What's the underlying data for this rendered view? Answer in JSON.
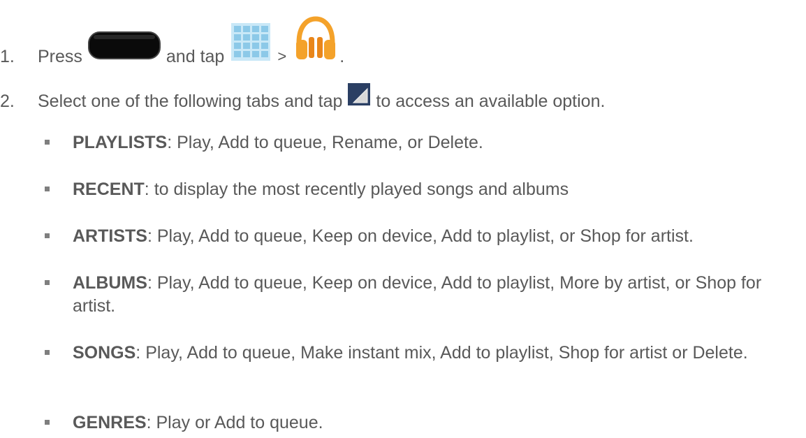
{
  "steps": [
    {
      "number": "1.",
      "parts": {
        "press": "Press",
        "and_tap": "and tap",
        "separator": ">",
        "period": "."
      },
      "icons": [
        "home-key-icon",
        "apps-grid-icon",
        "play-music-headphones-icon"
      ]
    },
    {
      "number": "2.",
      "text_before": "Select one of the following tabs and tap",
      "icon": "menu-corner-icon",
      "text_after": "to access an available option."
    }
  ],
  "tabs": [
    {
      "term": "PLAYLISTS",
      "desc": ": Play, Add to queue, Rename, or Delete."
    },
    {
      "term": "RECENT",
      "desc": ": to display the most recently played songs and albums"
    },
    {
      "term": "ARTISTS",
      "desc": ": Play, Add to queue, Keep on device, Add to playlist, or Shop for artist."
    },
    {
      "term": "ALBUMS",
      "desc": ": Play, Add to queue, Keep on device, Add to playlist, More by artist, or Shop for artist."
    },
    {
      "term": "SONGS",
      "desc": ": Play, Add to queue, Make instant mix, Add to playlist, Shop for artist or Delete."
    },
    {
      "term": "GENRES",
      "desc": ": Play or Add to queue."
    }
  ],
  "colors": {
    "text": "#595959",
    "bullet": "#7f7f7f",
    "home_key": "#0a0a0a",
    "apps_grid": "#9fd3ee",
    "headphones_orange": "#f4a22a"
  }
}
